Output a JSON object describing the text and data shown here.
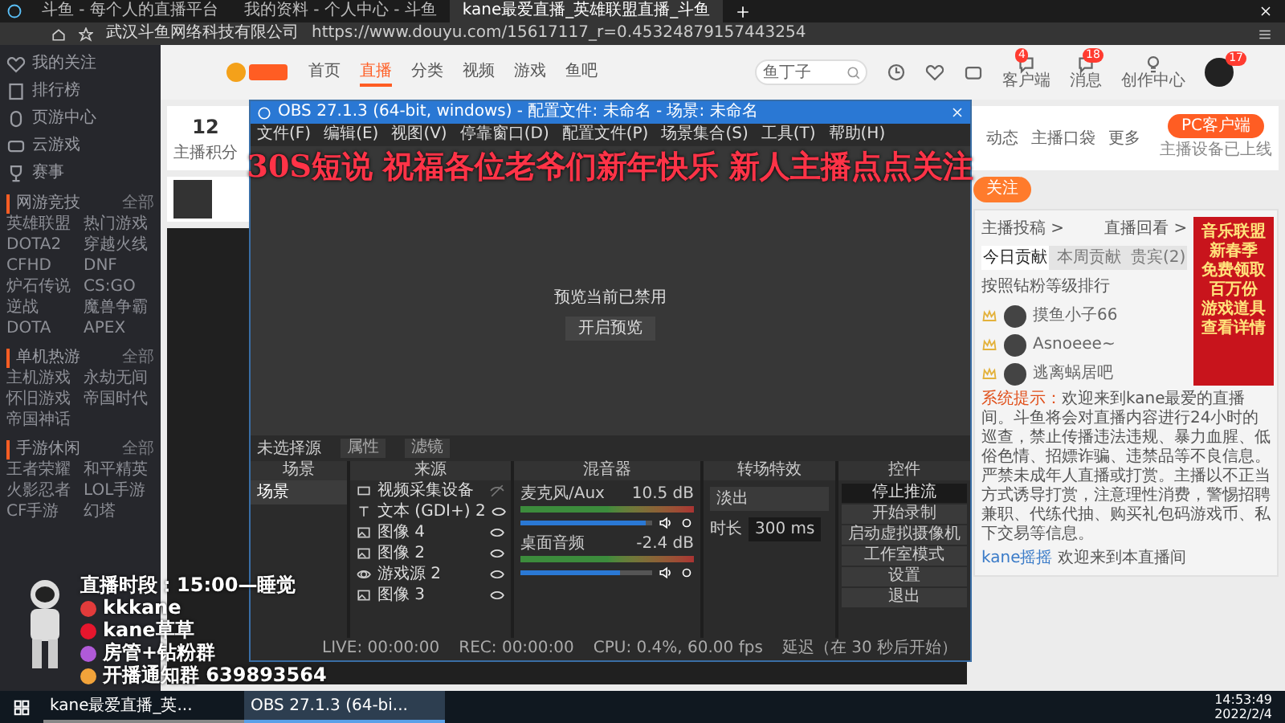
{
  "browser": {
    "tabs": [
      {
        "label": "斗鱼 - 每个人的直播平台",
        "selected": false
      },
      {
        "label": "我的资料 - 个人中心 - 斗鱼",
        "selected": false
      },
      {
        "label": "kane最爱直播_英雄联盟直播_斗鱼",
        "selected": true
      }
    ],
    "site_name": "武汉斗鱼网络科技有限公司",
    "url": "https://www.douyu.com/15617117_r=0.45324879157443254"
  },
  "sidebar": {
    "items": [
      "我的关注",
      "排行榜",
      "页游中心",
      "云游戏",
      "赛事"
    ],
    "sections": [
      {
        "title": "网游竞技",
        "more": "全部",
        "games": [
          "英雄联盟",
          "热门游戏",
          "DOTA2",
          "穿越火线",
          "CFHD",
          "DNF",
          "炉石传说",
          "CS:GO",
          "逆战",
          "魔兽争霸",
          "DOTA",
          "APEX"
        ]
      },
      {
        "title": "单机热游",
        "more": "全部",
        "games": [
          "主机游戏",
          "永劫无间",
          "怀旧游戏",
          "帝国时代",
          "帝国神话"
        ]
      },
      {
        "title": "手游休闲",
        "more": "全部",
        "games": [
          "王者荣耀",
          "和平精英",
          "火影忍者",
          "LOL手游",
          "CF手游",
          "幻塔"
        ]
      }
    ]
  },
  "header": {
    "nav": [
      {
        "label": "首页",
        "selected": false
      },
      {
        "label": "直播",
        "selected": true
      },
      {
        "label": "分类",
        "selected": false
      },
      {
        "label": "视频",
        "selected": false
      },
      {
        "label": "游戏",
        "selected": false
      },
      {
        "label": "鱼吧",
        "selected": false
      }
    ],
    "search": {
      "placeholder": "鱼丁子"
    },
    "icons": [
      {
        "kind": "history"
      },
      {
        "kind": "heart"
      },
      {
        "kind": "video"
      },
      {
        "kind": "client",
        "label": "客户端",
        "badge": "4"
      },
      {
        "kind": "message",
        "label": "消息",
        "badge": "18"
      },
      {
        "kind": "bulb",
        "label": "创作中心"
      }
    ],
    "avatar_badge": "17"
  },
  "room": {
    "score": "12",
    "score_label": "主播积分",
    "tools": [
      "动态",
      "主播口袋",
      "更多"
    ],
    "pc_button": "PC客户端",
    "pc_note": "主播设备已上线",
    "follow": "关注"
  },
  "rank": {
    "links": [
      "主播投稿 >",
      "直播回看 >"
    ],
    "tabs": [
      {
        "label": "今日贡献",
        "selected": true
      },
      {
        "label": "本周贡献",
        "selected": false
      },
      {
        "label": "贵宾(2)",
        "selected": false
      }
    ],
    "title": "按照钻粉等级排行",
    "users": [
      "摸鱼小子66",
      "Asnoeee~",
      "逃离蜗居吧"
    ],
    "system_label": "系统提示：",
    "system_text": "欢迎来到kane最爱的直播间。斗鱼将会对直播内容进行24小时的巡查，禁止传播违法违规、暴力血腥、低俗色情、招嫖诈骗、违禁品等不良信息。严禁未成年人直播或打赏。主播以不正当方式诱导打赏，注意理性消费，警惕招聘兼职、代练代抽、购买礼包码游戏币、私下交易等信息。",
    "chat_user": "kane摇摇",
    "chat_text": "欢迎来到本直播间"
  },
  "ad": [
    "音乐联盟",
    "新春季",
    "免费领取",
    "百万份",
    "游戏道具",
    "查看详情"
  ],
  "obs": {
    "title": "OBS 27.1.3 (64-bit, windows) - 配置文件: 未命名 - 场景: 未命名",
    "menu": [
      "文件(F)",
      "编辑(E)",
      "视图(V)",
      "停靠窗口(D)",
      "配置文件(P)",
      "场景集合(S)",
      "工具(T)",
      "帮助(H)"
    ],
    "preview_text": "预览当前已禁用",
    "preview_button": "开启预览",
    "no_source": "未选择源",
    "source_buttons": [
      "属性",
      "滤镜"
    ],
    "scenes": {
      "title": "场景",
      "items": [
        {
          "label": "场景",
          "selected": true
        }
      ]
    },
    "sources": {
      "title": "来源",
      "items": [
        {
          "kind": "camera",
          "label": "视频采集设备",
          "visible": false
        },
        {
          "kind": "text",
          "label": "文本 (GDI+) 2",
          "visible": true
        },
        {
          "kind": "image",
          "label": "图像 4",
          "visible": true
        },
        {
          "kind": "image",
          "label": "图像 2",
          "visible": true
        },
        {
          "kind": "game",
          "label": "游戏源 2",
          "visible": true
        },
        {
          "kind": "image",
          "label": "图像 3",
          "visible": true
        }
      ]
    },
    "mixer": {
      "title": "混音器",
      "channels": [
        {
          "name": "麦克风/Aux",
          "reading": "10.5 dB",
          "level": 0.95
        },
        {
          "name": "桌面音频",
          "reading": "-2.4 dB",
          "level": 0.75
        }
      ]
    },
    "transitions": {
      "title": "转场特效",
      "type": "淡出",
      "duration_label": "时长",
      "duration": "300 ms"
    },
    "controls": {
      "title": "控件",
      "stream_button": "停止推流",
      "buttons": [
        "开始录制",
        "启动虚拟摄像机",
        "工作室模式",
        "设置",
        "退出"
      ]
    },
    "status": {
      "live": "LIVE: 00:00:00",
      "rec": "REC: 00:00:00",
      "cpu": "CPU: 0.4%, 60.00 fps",
      "delay": "延迟（在 30 秒后开始）"
    }
  },
  "overlay": {
    "banner": "30S短说 祝福各位老爷们新年快乐 新人主播点点关注",
    "lines": [
      {
        "kind": "schedule",
        "text": "直播时段：15:00—睡觉"
      },
      {
        "kind": "netease",
        "text": "kkkane"
      },
      {
        "kind": "weibo",
        "text": "kane草草"
      },
      {
        "kind": "group",
        "text": "房管+钻粉群"
      },
      {
        "kind": "notify",
        "text": "开播通知群 639893564"
      }
    ]
  },
  "taskbar": {
    "apps": [
      {
        "label": "kane最爱直播_英...",
        "selected": false
      },
      {
        "label": "OBS 27.1.3 (64-bi...",
        "selected": true
      }
    ],
    "time": "14:53:49",
    "date": "2022/2/4"
  }
}
